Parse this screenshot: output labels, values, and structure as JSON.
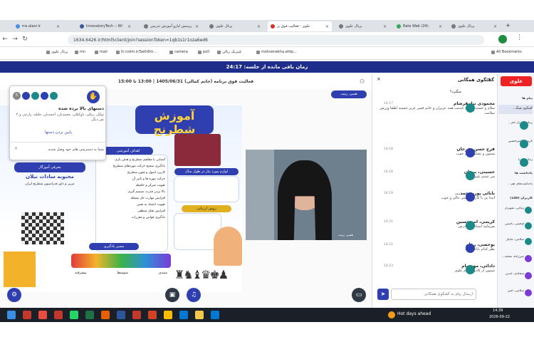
{
  "browser": {
    "tabs": [
      {
        "label": "ms.alavi.ir",
        "color": "#4a90e2"
      },
      {
        "label": "InnovatoryTech :: Wi",
        "color": "#3b5998"
      },
      {
        "label": "پرسش لیارو آموزش تدریس",
        "color": "#777"
      },
      {
        "label": "پرتال علوی",
        "color": "#777"
      },
      {
        "label": "علوی - فعالیت فوق بر",
        "color": "#d93025",
        "active": true
      },
      {
        "label": "پرتال علوی",
        "color": "#777"
      },
      {
        "label": "Rate Web (24)",
        "color": "#34a853"
      },
      {
        "label": "پرتال علوی",
        "color": "#777"
      }
    ],
    "url": "1634.6426.ir/html5client/join?sessionToken=1qb1s1r1oza6ed6",
    "bookmarks": [
      "پرتال علوی",
      "mn",
      "mail",
      "fc:cslim.ir/Seth8m...",
      "camera",
      "poll",
      "بلیتزبک ریالی",
      "mohsenekha.ehtp...",
      "All Bookmarks"
    ]
  },
  "session": {
    "timer": "زمان باقی مانده از جلسه: 24:17",
    "title": "فعالیت فوق برنامه (حاتم کمالی) 1405/06/31 | 13:00 تا 15:00",
    "presenter_badge": "همبر، ربیب"
  },
  "popup": {
    "title": "دستهای بالا برده شده",
    "body": "توکل، زینلی، ناوکیلان، محمدیان، احمدیان، جلیله، زارعی و ۲ نفر دیگر",
    "button": "پایین بردن دستها",
    "notice": "شما به دسترسی های خود وصل شدید",
    "count": "5"
  },
  "poster": {
    "main_title": "آموزش شطرنج",
    "goals_title": "اهداف آموزشی",
    "goals": [
      "آشنایی با مفاهیم شطرنج و هدف بازی",
      "یادگیری صحیح حرکت مهره‌های شطرنج",
      "کاربرد اصول و فنون شطرنج",
      "حرکت مهره ها و تاثیر آن",
      "تقویت تمرکز و حافظه",
      "بالا بردن قدرت تصمیم گیری",
      "افزایش مهارت حل مسئله",
      "تقویت اعتماد به نفس",
      "افزایش تفکر منطقی",
      "یادگیری قوانین و مقررات"
    ],
    "teacher_label": "معرفی آموزگار",
    "teacher_name": "محبوبه سادات نیلان",
    "teacher_desc": "مربی و داور فدراسیون شطرنج ایران",
    "eval_title": "روش ارزیابی",
    "materials_title": "لوازم مورد نیاز در طول سال",
    "path_title": "مسیر یادگیری",
    "levels": [
      "مبتدی",
      "متوسط",
      "پیشرفته"
    ]
  },
  "chat": {
    "title": "گفتگوی همگانی",
    "messages": [
      {
        "name": "محمودی نیا، فرشام",
        "time": "14:17",
        "text": "سلام و خسته نباشید خدمت همه عزیزان و خانم قمیر عزیز حسینه لطفا ورزش سلامت"
      },
      {
        "name": "فرج حسن، فرحان",
        "time": "14:18",
        "text": "ممنون و تشکر خیلی خوب"
      },
      {
        "name": "حسینی، برهان",
        "time": "14:18",
        "text": "من عیدی بلیم"
      },
      {
        "name": "بابائی پور، محمد...",
        "time": "14:19",
        "text": "ابتدا یی یا کارت داشتی عالی و خوب"
      },
      {
        "name": "کریمی، امیرحسین",
        "time": "14:21",
        "text": "بفرمایید استاد اوان درس"
      },
      {
        "name": "یوحصی، رهام",
        "time": "14:22",
        "text": "نظر کدام بابام دقیقا"
      },
      {
        "name": "دادائی، مهرسام",
        "time": "14:23",
        "text": "ممنون از کادر محترم علوی"
      }
    ],
    "input_placeholder": "ارسال پیام به گفتگوی همگانی",
    "last_asker": "میگیرد؟"
  },
  "sidebar": {
    "logo": "علوی",
    "messages_title": "پیام ها",
    "public_chat": "گفتگوی همگ...",
    "items": [
      "ربیاد شهریار حم...",
      "کریمی، امیرحسین",
      "زمانی، آریا"
    ],
    "notes_title": "یادداشت ها",
    "shared_notes": "یادداشت‌های هم...",
    "users_title": "کاربران (140)",
    "users": [
      "زمانی، شهریار",
      "اوچینی، یاسین",
      "سلامی، مانیار",
      "صرزاده، محمد...",
      "سجادی، آیدین",
      "سلامی، امیر"
    ]
  },
  "taskbar": {
    "weather": "Hot days ahead",
    "time": "14:39",
    "date": "2026-09-22"
  }
}
